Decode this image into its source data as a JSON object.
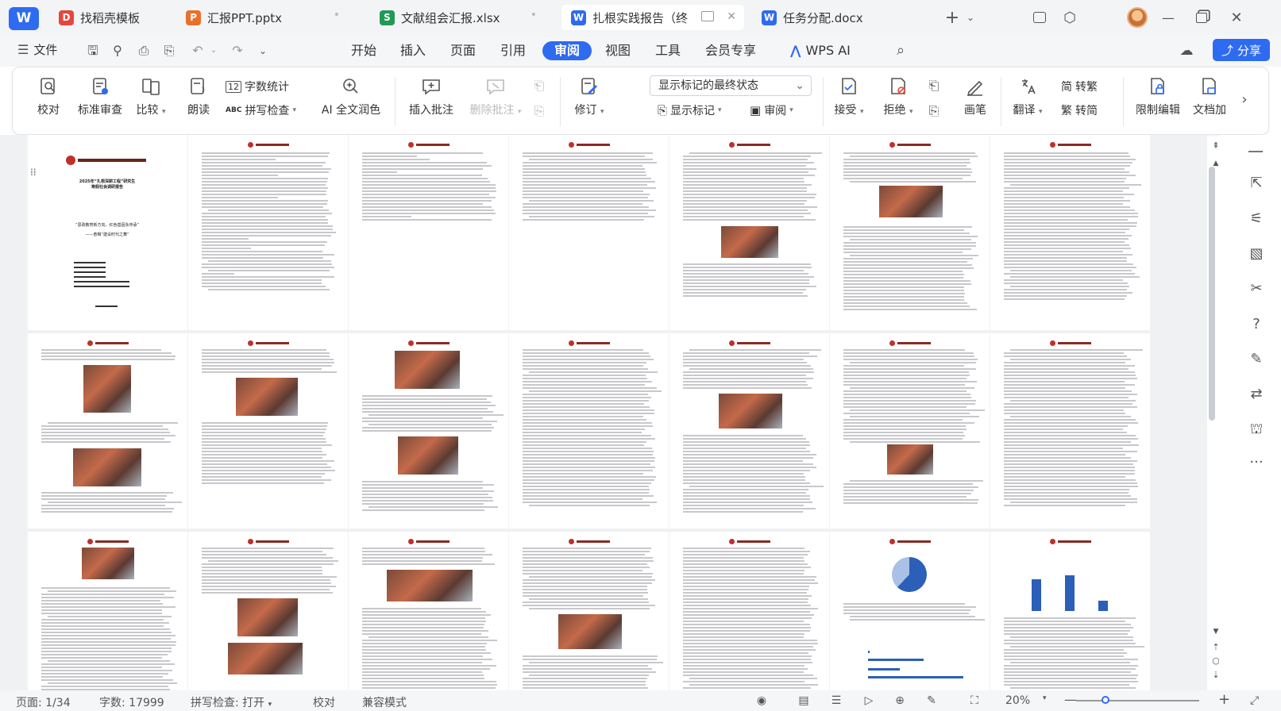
{
  "app": {
    "logo": "W",
    "accent": "#2f6bf0"
  },
  "tabs": [
    {
      "label": "找稻壳模板",
      "icon": "D",
      "icon_color": "#e8463c",
      "icon_name": "docer-icon"
    },
    {
      "label": "汇报PPT.pptx",
      "icon": "P",
      "icon_color": "#e8702a",
      "icon_name": "ppt-icon"
    },
    {
      "label": "文献组会汇报.xlsx",
      "icon": "S",
      "icon_color": "#1f9a55",
      "icon_name": "sheet-icon"
    },
    {
      "label": "扎根实践报告（终",
      "icon": "W",
      "icon_color": "#2f6bf0",
      "icon_name": "word-icon"
    },
    {
      "label": "任务分配.docx",
      "icon": "W",
      "icon_color": "#2f6bf0",
      "icon_name": "word-icon"
    }
  ],
  "menu": {
    "file": "文件",
    "items": [
      "开始",
      "插入",
      "页面",
      "引用",
      "审阅",
      "视图",
      "工具",
      "会员专享"
    ],
    "active": "审阅",
    "wps_ai": "WPS AI",
    "share": "分享"
  },
  "ribbon": {
    "proofread": "校对",
    "standard_review": "标准审查",
    "compare": "比较",
    "read_aloud": "朗读",
    "word_count": "字数统计",
    "spell_check": "拼写检查",
    "spell_prefix": "ABC",
    "ai_polish": "AI 全文润色",
    "insert_comment": "插入批注",
    "delete_comment": "删除批注",
    "revise": "修订",
    "markup_state": "显示标记的最终状态",
    "show_markup": "显示标记",
    "review_pane": "审阅",
    "accept": "接受",
    "reject": "拒绝",
    "pen": "画笔",
    "translate": "翻译",
    "to_traditional": "转繁",
    "to_simplified": "转简",
    "restrict_edit": "限制编辑",
    "doc_encrypt": "文档加"
  },
  "status": {
    "page": "页面: 1/34",
    "words": "字数: 17999",
    "spellcheck": "拼写检查: 打开",
    "proof": "校对",
    "compat": "兼容模式",
    "zoom": "20%"
  },
  "doc": {
    "cover_title": "2025年“扎根深耕工程”研究生\n寒假社会调研报告",
    "cover_subtitle": "“思政教育新方向，红色基因永传承”\n——奋楫“建设时代之舞”",
    "charts_present": [
      "pie-chart-page",
      "bar-chart-page"
    ]
  }
}
